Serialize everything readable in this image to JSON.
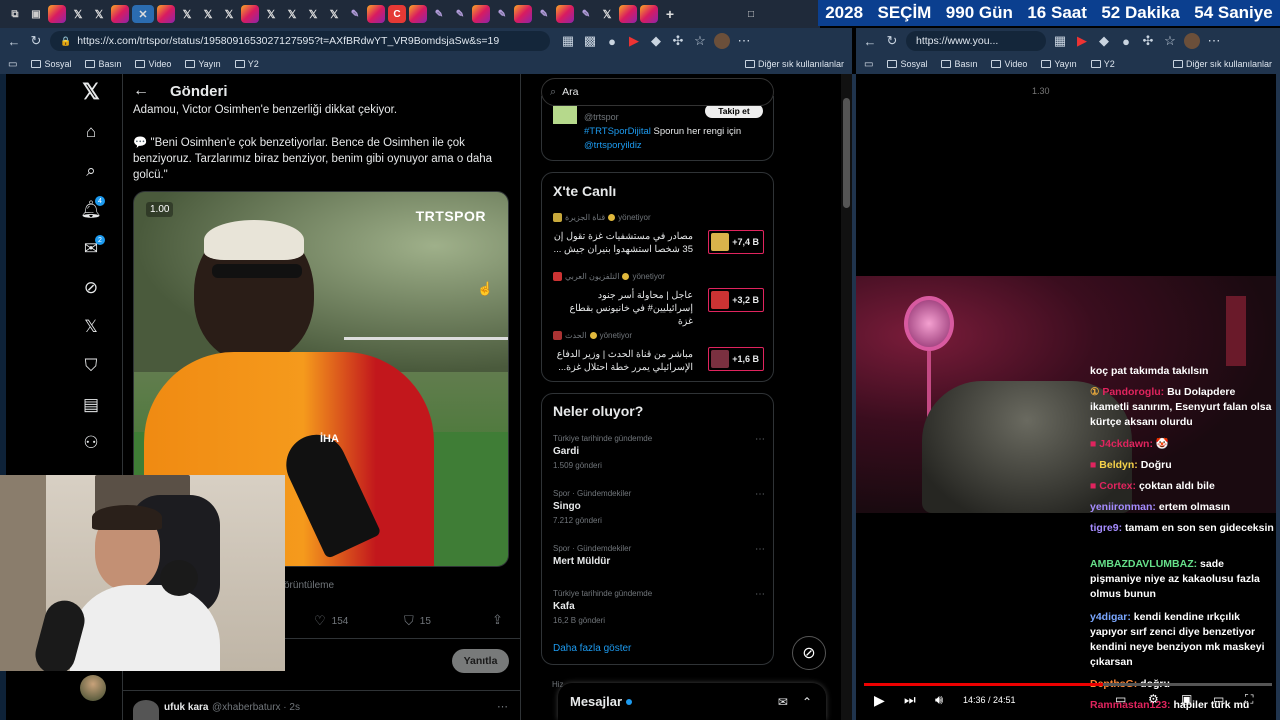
{
  "countdown": {
    "year": "2028",
    "label": "SEÇİM",
    "days": "990 Gün",
    "hours": "16 Saat",
    "minutes": "52 Dakika",
    "seconds": "54 Saniye"
  },
  "left_browser": {
    "url": "https://x.com/trtspor/status/1958091653027127595?t=AXfBRdwYT_VR9BomdsjaSw&s=19",
    "bookmarks": [
      "Sosyal",
      "Basın",
      "Video",
      "Yayın",
      "Y2"
    ],
    "other_bookmarks": "Diğer sık kullanılanlar"
  },
  "right_browser": {
    "url": "https://www.you...",
    "bookmarks": [
      "Sosyal",
      "Basın",
      "Video",
      "Yayın",
      "Y2"
    ],
    "other_bookmarks": "Diğer sık kullanılanlar"
  },
  "x": {
    "header_title": "Gönderi",
    "post_text_top": "Adamou, Victor Osimhen'e benzerliği dikkat çekiyor.",
    "post_quote": "💬 \"Beni Osimhen'e çok benzetiyorlar. Bence de Osimhen ile çok benziyoruz. Tarzlarımız biraz benziyor, benim gibi oynuyor ama o daha golcü.\"",
    "video_speed": "1.00",
    "video_watermark": "TRTSPOR",
    "mic_label": "İHA",
    "views_suffix": "örüntüleme",
    "likes": "154",
    "bookmarks": "15",
    "reply_button": "Yanıtla",
    "reply_user": "ufuk kara",
    "reply_handle": "@xhaberbaturx · 2s",
    "notif_badge": "4",
    "msg_badge": "2",
    "search_placeholder": "Ara",
    "follow_card": {
      "handle": "@trtspor",
      "button": "Takip et",
      "hashtag": "#TRTSporDijital",
      "text": "Sporun her rengi için",
      "link": "@trtsporyildiz"
    },
    "live": {
      "title": "X'te Canlı",
      "items": [
        {
          "source": "قناة الجزيرة",
          "status": "yönetiyor",
          "text": "مصادر في مستشفيات غزة تقول إن 35 شخصا استشهدوا بنيران جيش ...",
          "count": "+7,4 B"
        },
        {
          "source": "التلفزيون العربي",
          "status": "yönetiyor",
          "text": "عاجل | محاولة أسر جنود إسرائيليين# في خانيونس بقطاع غزة",
          "count": "+3,2 B"
        },
        {
          "source": "الحدث",
          "status": "yönetiyor",
          "text": "مباشر من قناة الحدث | وزير الدفاع الإسرائيلي يمرر خطة احتلال غزة...",
          "count": "+1,6 B"
        }
      ]
    },
    "trends": {
      "title": "Neler oluyor?",
      "items": [
        {
          "meta": "Türkiye tarihinde gündemde",
          "title": "Gardi",
          "count": "1.509 gönderi"
        },
        {
          "meta": "Spor · Gündemdekiler",
          "title": "Singo",
          "count": "7.212 gönderi"
        },
        {
          "meta": "Spor · Gündemdekiler",
          "title": "Mert Müldür",
          "count": ""
        },
        {
          "meta": "Türkiye tarihinde gündemde",
          "title": "Kafa",
          "count": "16,2 B gönderi"
        }
      ],
      "more": "Daha fazla göster"
    },
    "messages_label": "Mesajlar",
    "bottom_partial": "Hiz"
  },
  "yt": {
    "speed": "1.30",
    "time": "14:36 / 24:51",
    "chat_top": "koç pat takımda takılsın",
    "chat": [
      {
        "user": "Pandoroglu:",
        "text": "Bu Dolapdere ikametli sanırım, Esenyurt falan olsa kürtçe aksanı olurdu",
        "color": "#e0245e"
      },
      {
        "user": "J4ckdawn:",
        "text": "🤡",
        "color": "#e0245e"
      },
      {
        "user": "Beldyn:",
        "text": "Doğru",
        "color": "#f7d24a"
      },
      {
        "user": "Cortex:",
        "text": "çoktan aldı bile",
        "color": "#e0245e"
      },
      {
        "user": "yeniironman:",
        "text": "ertem olmasın",
        "color": "#a58cff"
      },
      {
        "user": "tigre9:",
        "text": "tamam en son sen gideceksin",
        "color": "#a58cff"
      },
      {
        "user": "AMBAZDAVLUMBAZ:",
        "text": "sade pişmaniye niye az kakaolusu fazla olmus bunun",
        "color": "#66e08a"
      },
      {
        "user": "y4digar:",
        "text": "kendi kendine ırkçılık yapıyor sırf zenci diye benzetiyor kendini neye benziyon mk maskeyi çıkarsan",
        "color": "#7aa7ff"
      },
      {
        "user": "DepthsG:",
        "text": "doğru",
        "color": "#ff8a3a"
      },
      {
        "user": "Rammastan123:",
        "text": "hapiler türk mü",
        "color": "#e0245e"
      }
    ]
  },
  "colors": {
    "accent": "#1d9bf0",
    "countdown_bg": "#0b3f8f",
    "live_border": "#e0245e"
  }
}
